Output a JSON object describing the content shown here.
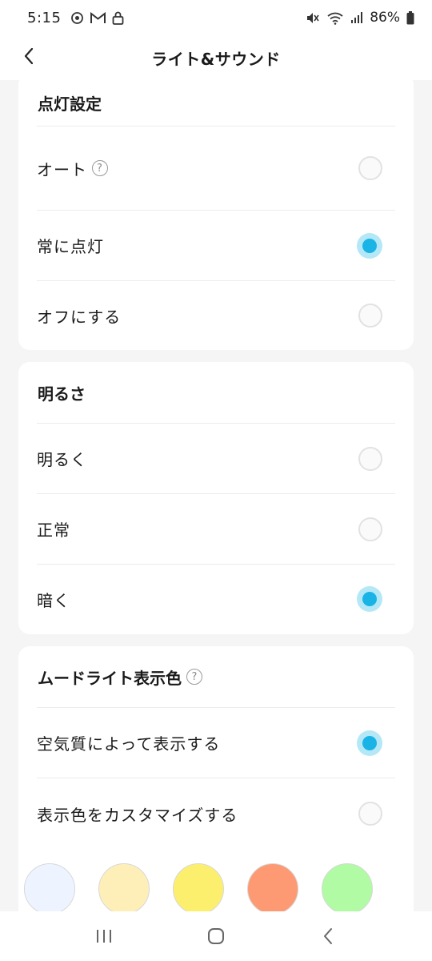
{
  "status_bar": {
    "time": "5:15",
    "battery": "86%",
    "left_icons": [
      "sync-icon",
      "gmail-icon",
      "lock-icon"
    ],
    "right_icons": [
      "mute-icon",
      "wifi-icon",
      "signal-icon",
      "battery-icon"
    ]
  },
  "header": {
    "title": "ライト&サウンド",
    "back_icon": "chevron-left-icon"
  },
  "lighting": {
    "title": "点灯設定",
    "options": [
      {
        "label": "オート",
        "has_help": true,
        "selected": false
      },
      {
        "label": "常に点灯",
        "has_help": false,
        "selected": true
      },
      {
        "label": "オフにする",
        "has_help": false,
        "selected": false
      }
    ]
  },
  "brightness": {
    "title": "明るさ",
    "options": [
      {
        "label": "明るく",
        "selected": false
      },
      {
        "label": "正常",
        "selected": false
      },
      {
        "label": "暗く",
        "selected": true
      }
    ]
  },
  "mood_light": {
    "title": "ムードライト表示色",
    "has_help": true,
    "options": [
      {
        "label": "空気質によって表示する",
        "selected": true
      },
      {
        "label": "表示色をカスタマイズする",
        "selected": false
      }
    ],
    "swatches": [
      "#eef4ff",
      "#fdefb7",
      "#fdef6e",
      "#fd9a73",
      "#b0fba4"
    ]
  },
  "colors": {
    "accent": "#1ab3e6",
    "accent_halo": "#b4e8f7"
  },
  "help_glyph": "?",
  "navbar": {
    "buttons": [
      "recents-icon",
      "home-icon",
      "back-icon"
    ]
  }
}
